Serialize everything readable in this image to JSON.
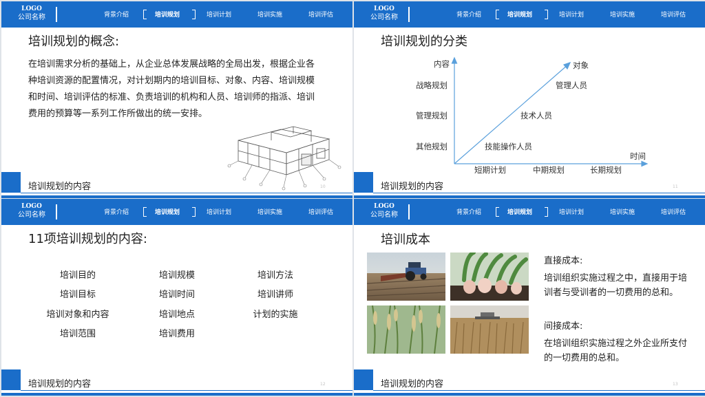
{
  "header": {
    "logo_mark": "LOGO",
    "company": "公司名称",
    "nav": [
      "背景介绍",
      "培训规划",
      "培训计划",
      "培训实施",
      "培训评估"
    ]
  },
  "footer": {
    "label": "培训规划的内容"
  },
  "slides": [
    {
      "page": "10",
      "title": "培训规划的概念:",
      "body": "在培训需求分析的基础上，从企业总体发展战略的全局出发，根据企业各种培训资源的配置情况，对计划期内的培训目标、对象、内容、培训规模和时间、培训评估的标准、负责培训的机构和人员、培训师的指派、培训费用的预算等一系列工作所做出的统一安排。"
    },
    {
      "page": "11",
      "title": "培训规划的分类",
      "chart": {
        "y_axis_label": "内容",
        "x_axis_label": "时间",
        "diagonal_label": "对象",
        "y_categories": [
          "其他规划",
          "管理规划",
          "战略规划"
        ],
        "x_categories": [
          "短期计划",
          "中期规划",
          "长期规划"
        ],
        "diagonal_labels": [
          "技能操作人员",
          "技术人员",
          "管理人员"
        ]
      }
    },
    {
      "page": "12",
      "title": "11项培训规划的内容:",
      "items": [
        [
          "培训目的",
          "培训目标",
          "培训对象和内容",
          "培训范围"
        ],
        [
          "培训规模",
          "培训时间",
          "培训地点",
          "培训费用"
        ],
        [
          "培训方法",
          "培训讲师",
          "计划的实施"
        ]
      ]
    },
    {
      "page": "13",
      "title": "培训成本",
      "direct_heading": "直接成本:",
      "direct_text": "培训组织实施过程之中，直接用于培训者与受训者的一切费用的总和。",
      "indirect_heading": "间接成本:",
      "indirect_text": "在培训组织实施过程之外企业所支付的一切费用的总和。"
    }
  ],
  "colors": {
    "brand": "#1a6dc9",
    "chart_line": "#5aa0dc"
  }
}
